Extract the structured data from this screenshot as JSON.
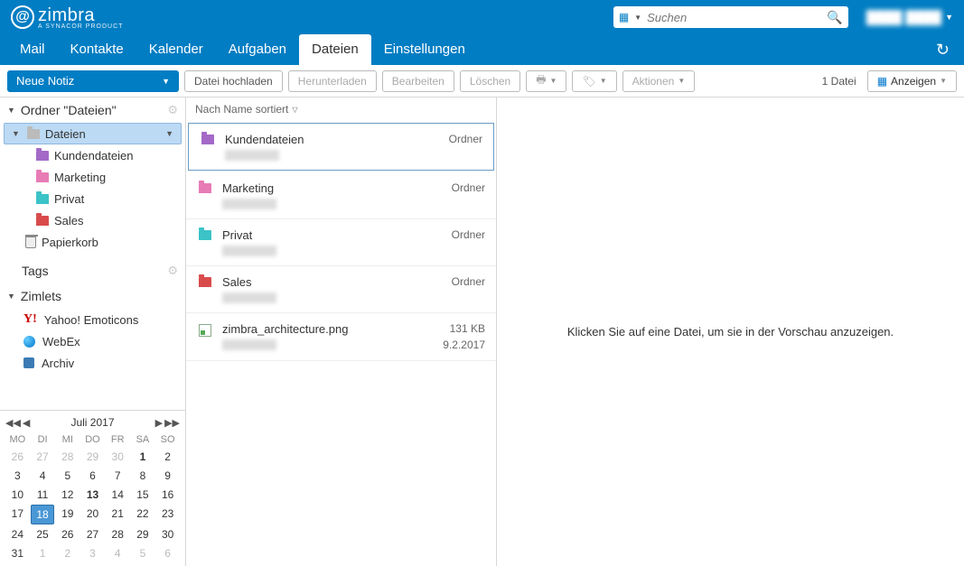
{
  "header": {
    "brand": "zimbra",
    "brand_sub": "A SYNACOR PRODUCT",
    "search_placeholder": "Suchen",
    "user_name": "████ ████"
  },
  "tabs": {
    "mail": "Mail",
    "contacts": "Kontakte",
    "calendar": "Kalender",
    "tasks": "Aufgaben",
    "files": "Dateien",
    "settings": "Einstellungen"
  },
  "toolbar": {
    "new_note": "Neue Notiz",
    "upload": "Datei hochladen",
    "download": "Herunterladen",
    "edit": "Bearbeiten",
    "delete": "Löschen",
    "actions": "Aktionen",
    "file_count": "1 Datei",
    "view": "Anzeigen"
  },
  "sidebar": {
    "folders_title": "Ordner \"Dateien\"",
    "root": "Dateien",
    "folders": {
      "0": {
        "name": "Kundendateien"
      },
      "1": {
        "name": "Marketing"
      },
      "2": {
        "name": "Privat"
      },
      "3": {
        "name": "Sales"
      }
    },
    "trash": "Papierkorb",
    "tags_title": "Tags",
    "zimlets_title": "Zimlets",
    "zimlets": {
      "0": {
        "name": "Yahoo! Emoticons"
      },
      "1": {
        "name": "WebEx"
      },
      "2": {
        "name": "Archiv"
      }
    }
  },
  "calendar": {
    "title": "Juli 2017",
    "days": {
      "0": "MO",
      "1": "DI",
      "2": "MI",
      "3": "DO",
      "4": "FR",
      "5": "SA",
      "6": "SO"
    }
  },
  "list": {
    "sort": "Nach Name sortiert",
    "folder_label": "Ordner",
    "items": {
      "0": {
        "name": "Kundendateien",
        "type": "Ordner",
        "meta2": ""
      },
      "1": {
        "name": "Marketing",
        "type": "Ordner",
        "meta2": ""
      },
      "2": {
        "name": "Privat",
        "type": "Ordner",
        "meta2": ""
      },
      "3": {
        "name": "Sales",
        "type": "Ordner",
        "meta2": ""
      },
      "4": {
        "name": "zimbra_architecture.png",
        "type": "131 KB",
        "meta2": "9.2.2017"
      }
    }
  },
  "preview": {
    "hint": "Klicken Sie auf eine Datei, um sie in der Vorschau anzuzeigen."
  }
}
